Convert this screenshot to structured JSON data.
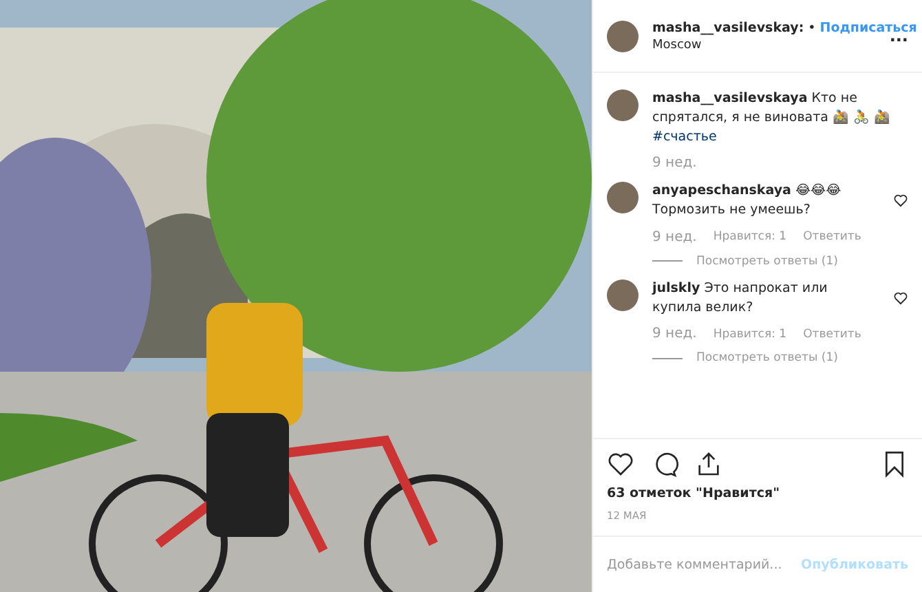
{
  "header": {
    "username": "masha__vasilevskay:",
    "separator": "•",
    "follow": "Подписаться",
    "location": "Moscow",
    "more": "..."
  },
  "caption": {
    "username": "masha__vasilevskaya",
    "text": "Кто не спрятался, я не виновата 🚵 🚴 🚵",
    "hashtag": "#счастье",
    "time": "9 нед."
  },
  "comments": [
    {
      "username": "anyapeschanskaya",
      "text": "😂😂😂 Тормозить не умеешь?",
      "time": "9 нед.",
      "likes": "Нравится: 1",
      "reply": "Ответить",
      "view_replies": "Посмотреть ответы (1)",
      "liked": false
    },
    {
      "username": "julskly",
      "text": "Это напрокат или купила велик?",
      "time": "9 нед.",
      "likes": "Нравится: 1",
      "reply": "Ответить",
      "view_replies": "Посмотреть ответы (1)",
      "liked": false
    }
  ],
  "likes": "63 отметок \"Нравится\"",
  "date": "12 МАЯ",
  "comment_field": {
    "placeholder": "Добавьте комментарий...",
    "post": "Опубликовать"
  }
}
